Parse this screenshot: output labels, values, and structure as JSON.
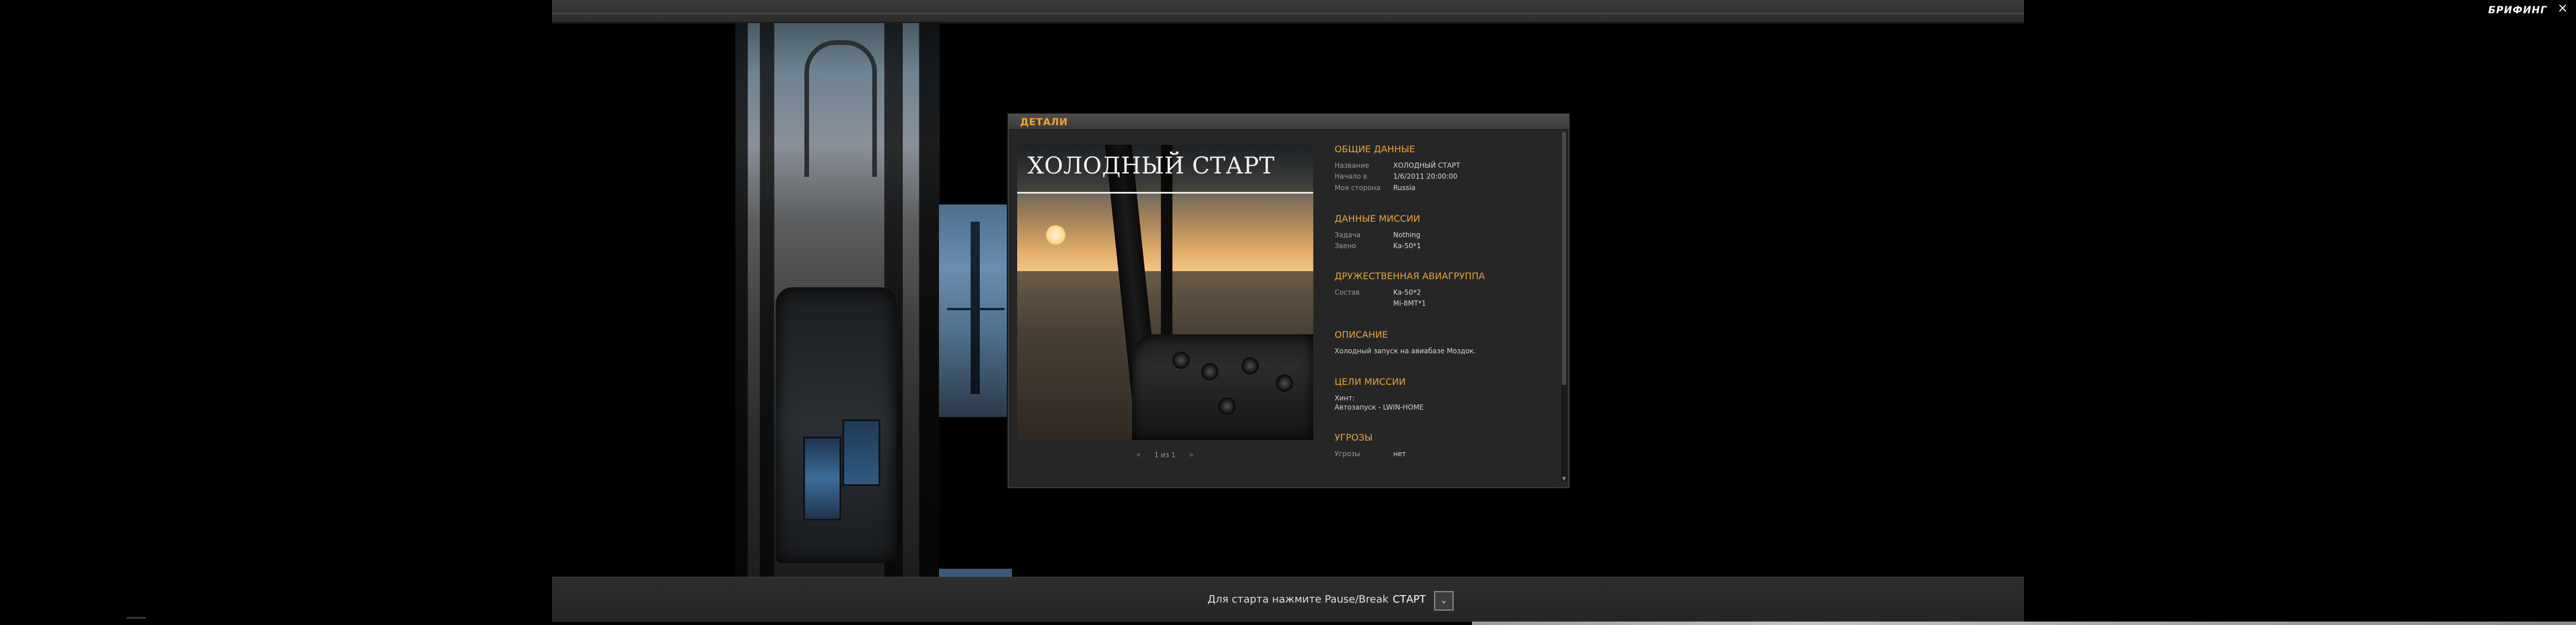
{
  "window": {
    "title": "БРИФИНГ",
    "close_glyph": "×"
  },
  "details": {
    "title": "ДЕТАЛИ",
    "image_title": "ХОЛОДНЫЙ СТАРТ",
    "pager": {
      "prev_glyph": "«",
      "text": "1 из 1",
      "next_glyph": "»"
    },
    "general": {
      "heading": "ОБЩИЕ ДАННЫЕ",
      "rows": [
        {
          "label": "Название",
          "value": "ХОЛОДНЫЙ СТАРТ"
        },
        {
          "label": "Начало в",
          "value": "1/6/2011   20:00:00"
        },
        {
          "label": "Моя сторона",
          "value": "Russia"
        }
      ]
    },
    "mission_data": {
      "heading": "ДАННЫЕ МИССИИ",
      "rows": [
        {
          "label": "Задача",
          "value": "Nothing"
        },
        {
          "label": "Звено",
          "value": "Ka-50*1"
        }
      ]
    },
    "friendly": {
      "heading": "ДРУЖЕСТВЕННАЯ АВИАГРУППА",
      "label": "Состав",
      "values": [
        "Ka-50*2",
        "Mi-8MT*1"
      ]
    },
    "description": {
      "heading": "ОПИСАНИЕ",
      "text": "Холодный запуск на авиабазе Моздок."
    },
    "objectives": {
      "heading": "ЦЕЛИ МИССИИ",
      "lines": [
        "Хинт:",
        "Автозапуск - LWIN-HOME"
      ]
    },
    "threats": {
      "heading": "УГРОЗЫ",
      "label": "Угрозы",
      "value": "нет"
    }
  },
  "footer": {
    "hint": "Для старта нажмите Pause/Break",
    "start_label": "СТАРТ",
    "dropdown_glyph": "⌄"
  },
  "colors": {
    "accent": "#e8a435",
    "panel_bg": "#262626",
    "bar_bg": "#2e2e2e"
  }
}
